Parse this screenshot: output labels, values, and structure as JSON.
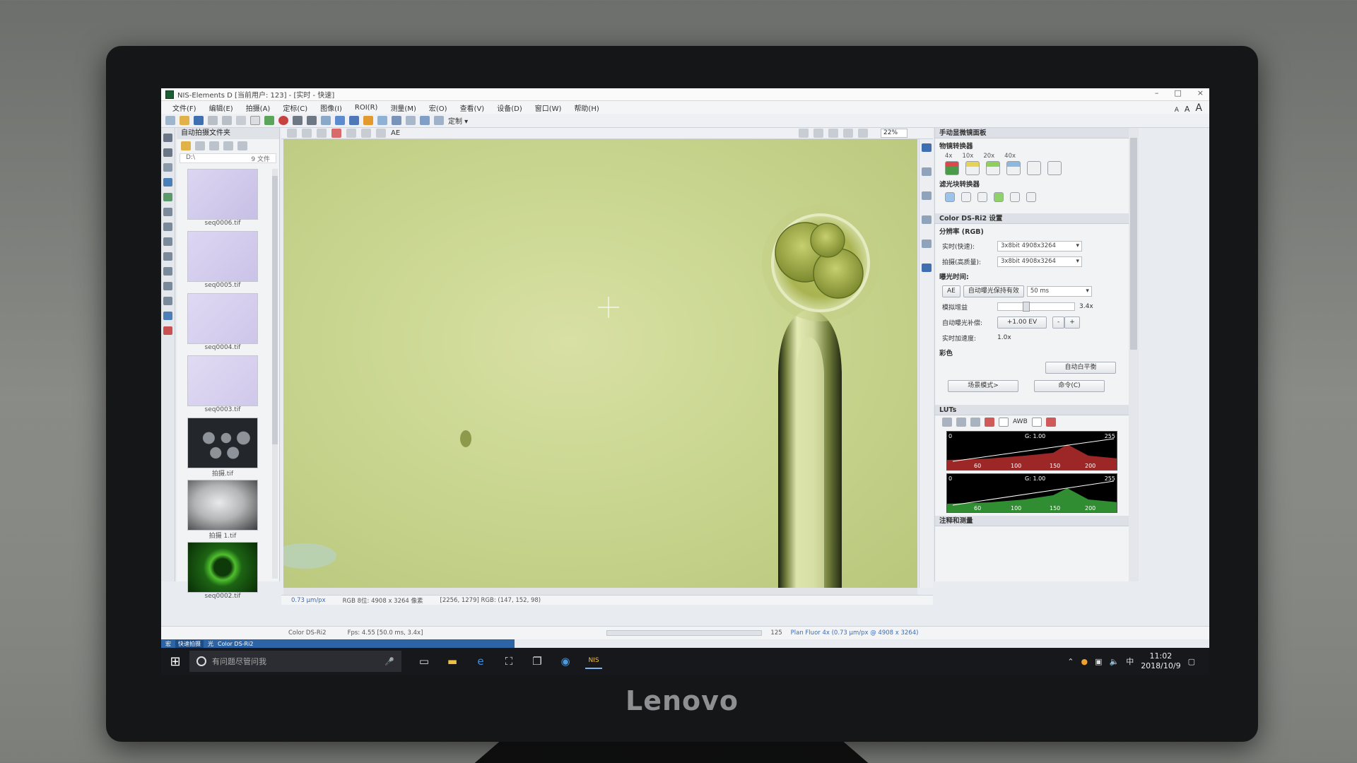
{
  "window": {
    "title": "NIS-Elements D [当前用户: 123] - [实时 - 快速]",
    "controls": [
      "–",
      "□",
      "×"
    ]
  },
  "menubar": {
    "items": [
      "文件(F)",
      "编辑(E)",
      "拍摄(A)",
      "定标(C)",
      "图像(I)",
      "ROI(R)",
      "测量(M)",
      "宏(O)",
      "查看(V)",
      "设备(D)",
      "窗口(W)",
      "帮助(H)"
    ]
  },
  "font_buttons": [
    "A",
    "A",
    "A"
  ],
  "toolbar": {
    "custom_label": "定制 ▾"
  },
  "file_panel": {
    "title": "自动拍摄文件夹",
    "path_left": "D:\\",
    "path_right": "9 文件",
    "thumbnails": [
      {
        "label": "seq0006.tif",
        "color": "#cfc8e9"
      },
      {
        "label": "seq0005.tif",
        "color": "#d2cbec"
      },
      {
        "label": "seq0004.tif",
        "color": "#d6cfef"
      },
      {
        "label": "seq0003.tif",
        "color": "#d7d0ee"
      },
      {
        "label": "拍摄.tif",
        "color": "#2a2d33"
      },
      {
        "label": "拍摄 1.tif",
        "color": "#bfc1c3"
      },
      {
        "label": "seq0002.tif",
        "color": "#174f10"
      }
    ]
  },
  "viewer": {
    "zoom": "22%",
    "toolbar_label": "AE"
  },
  "statusbar": {
    "scale": "0.73 µm/px",
    "image_info": "RGB 8位: 4908 x 3264 像素",
    "cursor": "[2256, 1279] RGB: (147, 152, 98)",
    "fps": "Fps: 4.55 [50.0 ms, 3.4x]",
    "camera": "Color DS-Ri2",
    "count": "125",
    "objective": "Plan Fluor 4x (0.73 µm/px @ 4908 x 3264)"
  },
  "right_panel": {
    "microscope_title": "手动显微镜面板",
    "objective_changer": "物镜转换器",
    "objective_labels": [
      "4x",
      "10x",
      "20x",
      "40x"
    ],
    "filter_changer": "滤光块转换器",
    "camera_title": "Color DS-Ri2 设置",
    "resolution": "分辨率 (RGB)",
    "live_label": "实时(快速):",
    "live_value": "3x8bit 4908x3264",
    "capture_label": "拍摄(高质量):",
    "capture_value": "3x8bit 4908x3264",
    "exposure": "曝光时间:",
    "ae_button": "AE",
    "auto_exposure_keep": "自动曝光保持有效",
    "exposure_value": "50 ms",
    "gain_label": "模拟增益",
    "gain_value": "3.4x",
    "auto_comp_label": "自动曝光补偿:",
    "auto_comp_value": "+1.00 EV",
    "accel_label": "实时加速度:",
    "accel_value": "1.0x",
    "color": "彩色",
    "awb_button": "自动白平衡",
    "scene_button": "场景模式>",
    "command_button": "命令(C)",
    "luts_title": "LUTs",
    "awb_label": "AWB",
    "lut_gamma_1": "G: 1.00",
    "lut_gamma_2": "G: 1.00",
    "lut_ticks": [
      "0",
      "60",
      "100",
      "150",
      "200",
      "255"
    ],
    "notes_title": "注释和测量"
  },
  "taskbar": {
    "search_placeholder": "有问题尽管问我",
    "time": "11:02",
    "date": "2018/10/9",
    "ime": "中",
    "app_label": "NIS"
  },
  "bottom_tabs": [
    "宏",
    "快速拍摄",
    "光",
    "Color DS-Ri2"
  ],
  "brand": "Lenovo"
}
